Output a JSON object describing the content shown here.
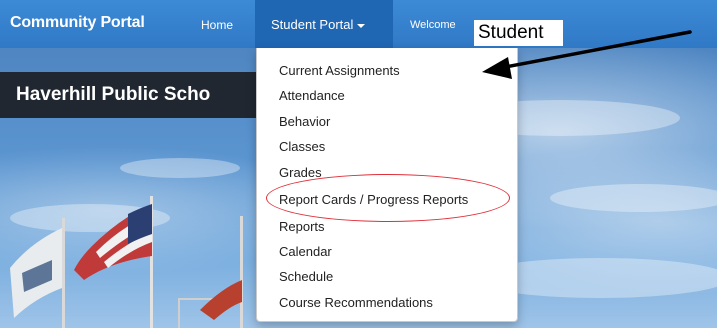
{
  "navbar": {
    "brand": "Community Portal",
    "home": "Home",
    "student_portal": "Student Portal",
    "welcome": "Welcome",
    "user_name": "Student"
  },
  "hero": {
    "school_title": "Haverhill Public Scho"
  },
  "dropdown": {
    "items": [
      "Current Assignments",
      "Attendance",
      "Behavior",
      "Classes",
      "Grades",
      "Report Cards / Progress Reports",
      "Reports",
      "Calendar",
      "Schedule",
      "Course Recommendations"
    ]
  },
  "colors": {
    "navbar": "#3079c6",
    "active_tab": "#1f66b3",
    "annotation_circle": "#e0303a",
    "arrow": "#000000"
  }
}
